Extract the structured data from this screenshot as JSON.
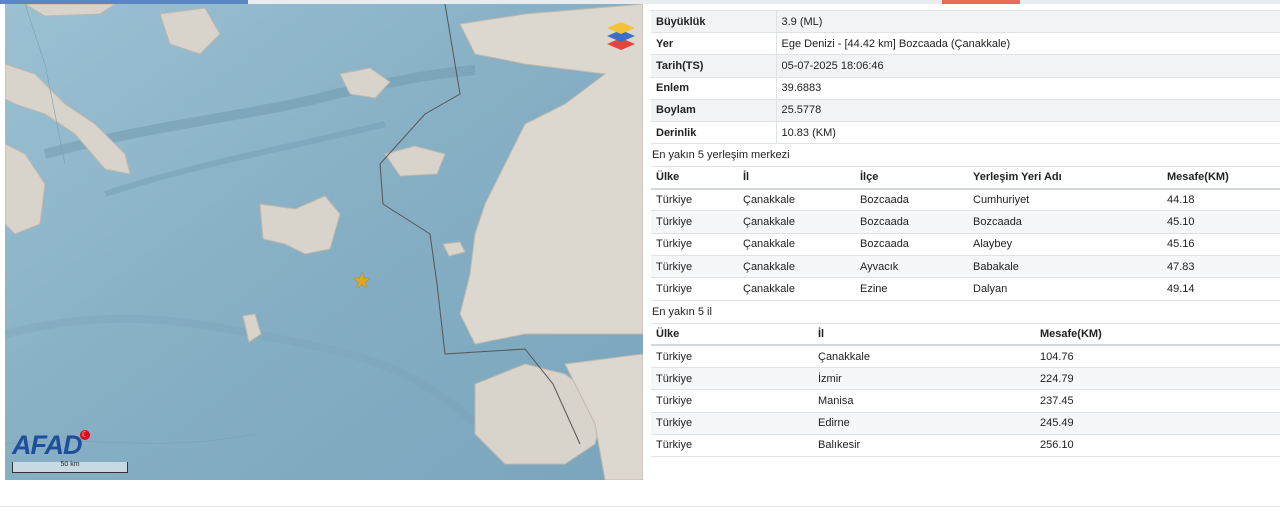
{
  "map": {
    "logo": "AFAD",
    "scale_label": "50 km",
    "colors": {
      "sea": "#8db4c9",
      "land": "#d9d6d0",
      "epicenter": "#e0a820"
    },
    "icons": [
      "layers-icon",
      "epicenter-star-icon",
      "turkey-flag-icon"
    ]
  },
  "details": [
    {
      "label": "Büyüklük",
      "value": "3.9 (ML)"
    },
    {
      "label": "Yer",
      "value": "Ege Denizi - [44.42 km] Bozcaada (Çanakkale)"
    },
    {
      "label": "Tarih(TS)",
      "value": "05-07-2025 18:06:46"
    },
    {
      "label": "Enlem",
      "value": "39.6883"
    },
    {
      "label": "Boylam",
      "value": "25.5778"
    },
    {
      "label": "Derinlik",
      "value": "10.83 (KM)"
    }
  ],
  "settlements": {
    "title": "En yakın 5 yerleşim merkezi",
    "headers": [
      "Ülke",
      "İl",
      "İlçe",
      "Yerleşim Yeri Adı",
      "Mesafe(KM)"
    ],
    "rows": [
      [
        "Türkiye",
        "Çanakkale",
        "Bozcaada",
        "Cumhuriyet",
        "44.18"
      ],
      [
        "Türkiye",
        "Çanakkale",
        "Bozcaada",
        "Bozcaada",
        "45.10"
      ],
      [
        "Türkiye",
        "Çanakkale",
        "Bozcaada",
        "Alaybey",
        "45.16"
      ],
      [
        "Türkiye",
        "Çanakkale",
        "Ayvacık",
        "Babakale",
        "47.83"
      ],
      [
        "Türkiye",
        "Çanakkale",
        "Ezine",
        "Dalyan",
        "49.14"
      ]
    ]
  },
  "provinces": {
    "title": "En yakın 5 il",
    "headers": [
      "Ülke",
      "İl",
      "Mesafe(KM)"
    ],
    "rows": [
      [
        "Türkiye",
        "Çanakkale",
        "104.76"
      ],
      [
        "Türkiye",
        "İzmir",
        "224.79"
      ],
      [
        "Türkiye",
        "Manisa",
        "237.45"
      ],
      [
        "Türkiye",
        "Edirne",
        "245.49"
      ],
      [
        "Türkiye",
        "Balıkesir",
        "256.10"
      ]
    ]
  }
}
